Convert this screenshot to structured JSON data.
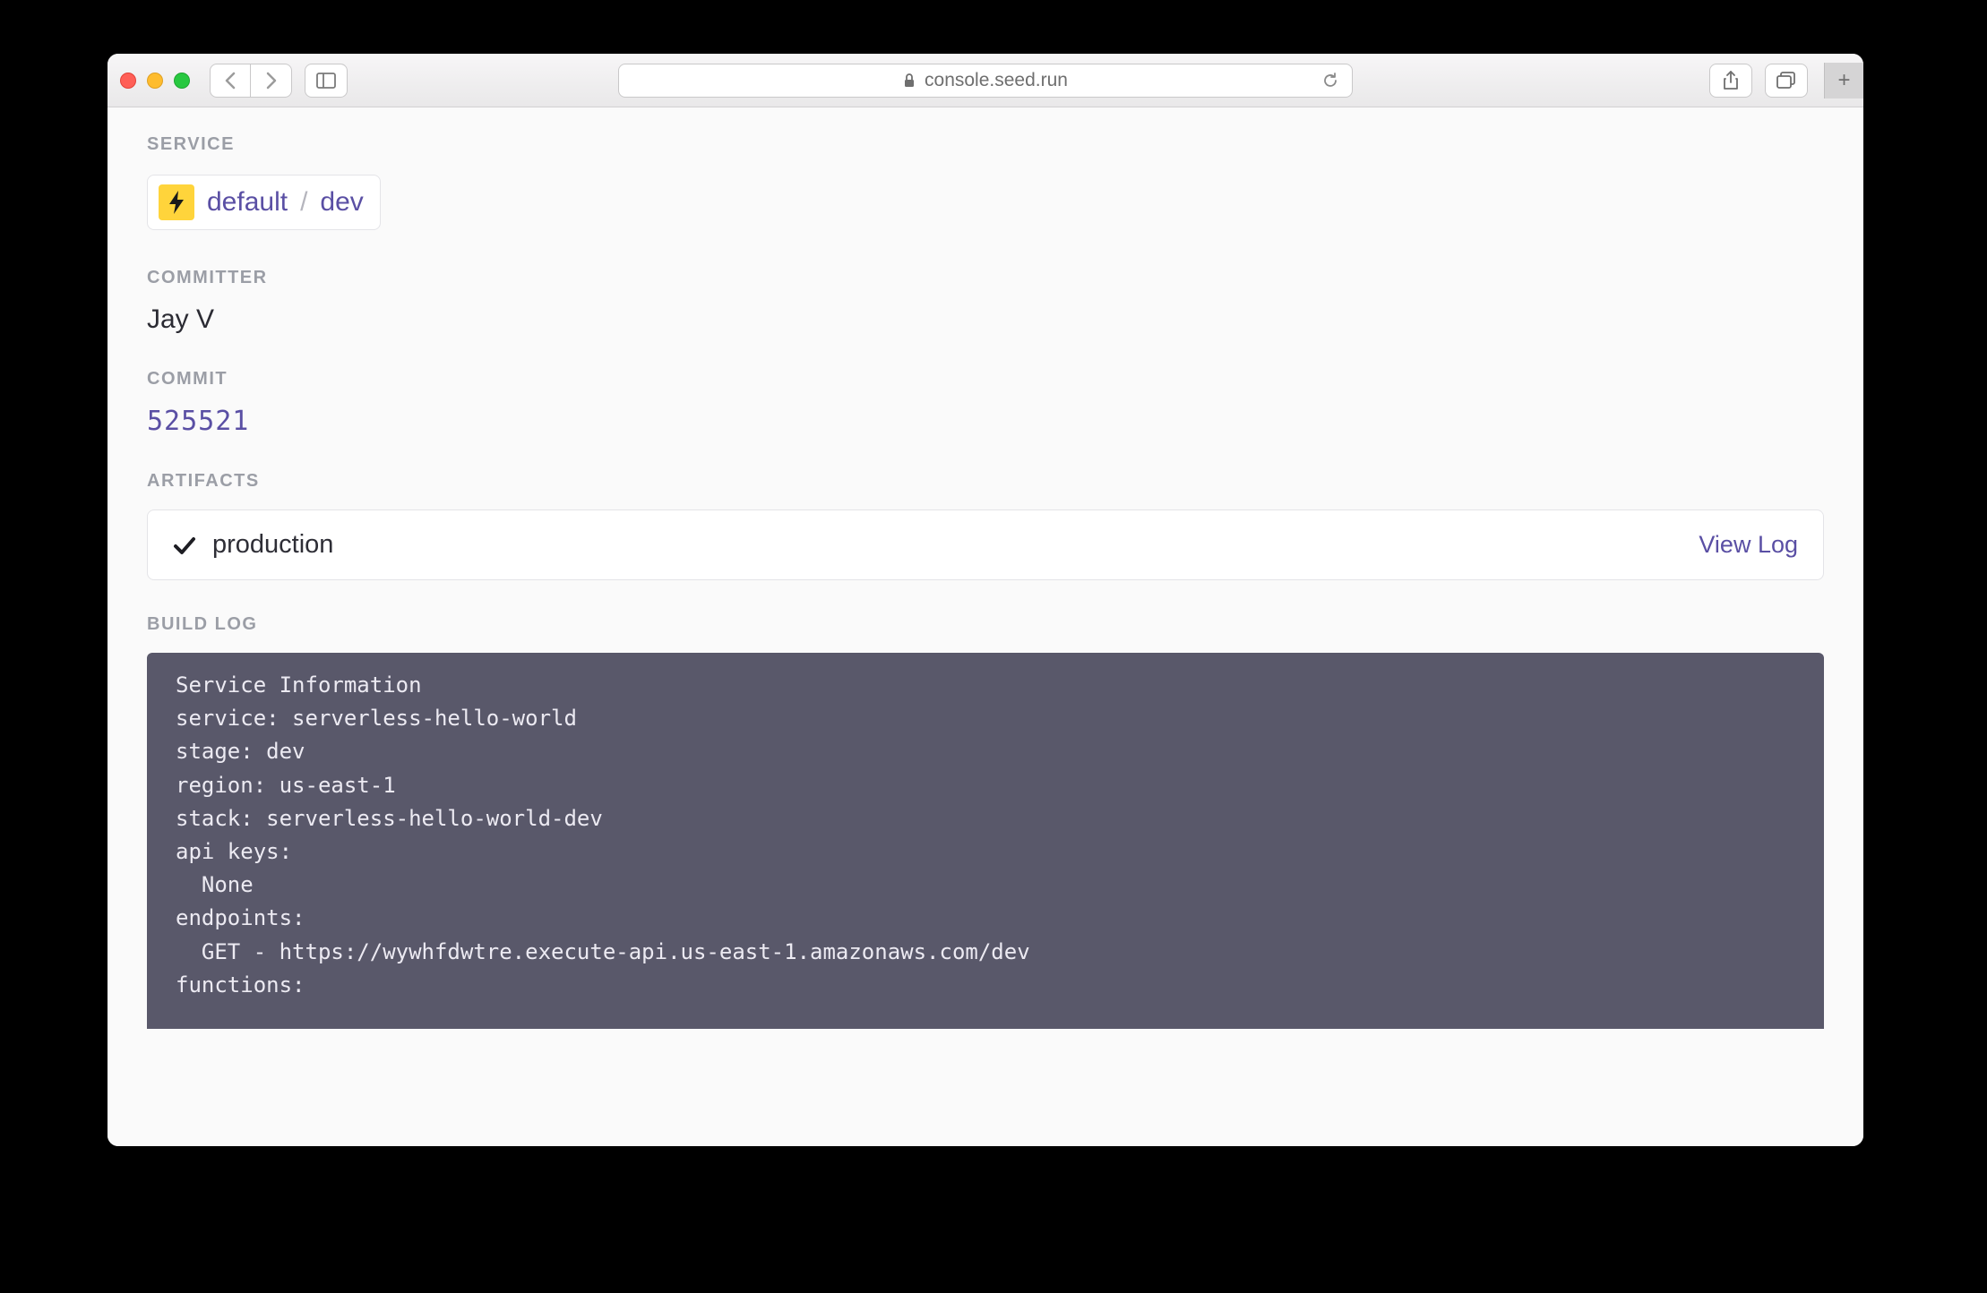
{
  "browser": {
    "url_host": "console.seed.run"
  },
  "labels": {
    "service": "SERVICE",
    "committer": "COMMITTER",
    "commit": "COMMIT",
    "artifacts": "ARTIFACTS",
    "build_log": "BUILD LOG"
  },
  "service": {
    "name": "default",
    "separator": "/",
    "stage": "dev"
  },
  "committer": {
    "name": "Jay V"
  },
  "commit": {
    "hash": "525521"
  },
  "artifacts": [
    {
      "name": "production",
      "action_label": "View Log"
    }
  ],
  "build_log_text": "Service Information\nservice: serverless-hello-world\nstage: dev\nregion: us-east-1\nstack: serverless-hello-world-dev\napi keys:\n  None\nendpoints:\n  GET - https://wywhfdwtre.execute-api.us-east-1.amazonaws.com/dev\nfunctions:"
}
